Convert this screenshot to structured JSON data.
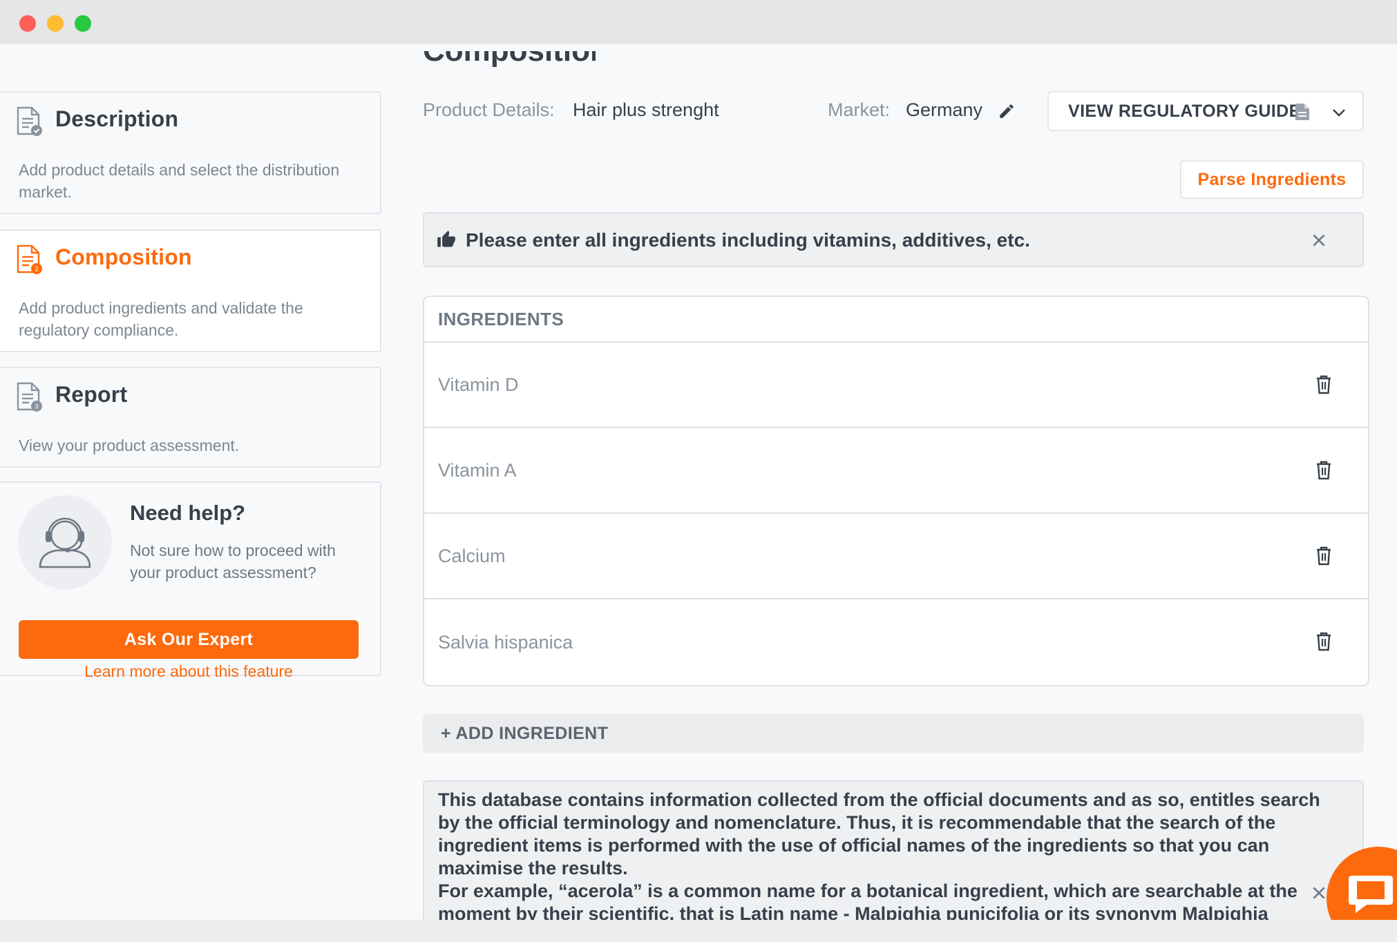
{
  "page": {
    "heading_partial": "Composition"
  },
  "sidebar": {
    "steps": [
      {
        "title": "Description",
        "description": "Add product details and select the distribution market.",
        "badge": ""
      },
      {
        "title": "Composition",
        "description": "Add product ingredients and validate the regulatory compliance.",
        "badge": "2"
      },
      {
        "title": "Report",
        "description": "View your product assessment.",
        "badge": "3"
      }
    ],
    "help": {
      "title": "Need help?",
      "description": "Not sure how to proceed with your product assessment?",
      "button_label": "Ask Our Expert",
      "link_label": "Learn more about this feature"
    }
  },
  "header": {
    "product_details_label": "Product Details:",
    "product_details_value": "Hair plus strenght",
    "market_label": "Market:",
    "market_value": "Germany",
    "regulatory_button_label": "VIEW REGULATORY GUIDE"
  },
  "actions": {
    "parse_label": "Parse Ingredients",
    "add_ingredient_label": "+ ADD INGREDIENT"
  },
  "hint": {
    "text": "Please enter all ingredients including vitamins, additives, etc."
  },
  "ingredients": {
    "header": "INGREDIENTS",
    "items": [
      "Vitamin D",
      "Vitamin A",
      "Calcium",
      "Salvia hispanica"
    ]
  },
  "info": {
    "text": "This database contains information collected from the official documents and as so, entitles search by the official terminology and nomenclature. Thus, it is recommendable that the search of the ingredient items is performed with the use of official names of the ingredients so that you can maximise the results.",
    "example": "For example, “acerola” is a common name for a botanical ingredient, which are searchable at the moment by their scientific, that is Latin name - Malpighia punicifolia or its synonym Malpighia"
  },
  "colors": {
    "accent": "#fd6a0d",
    "text": "#37404a",
    "muted": "#8a949e"
  }
}
